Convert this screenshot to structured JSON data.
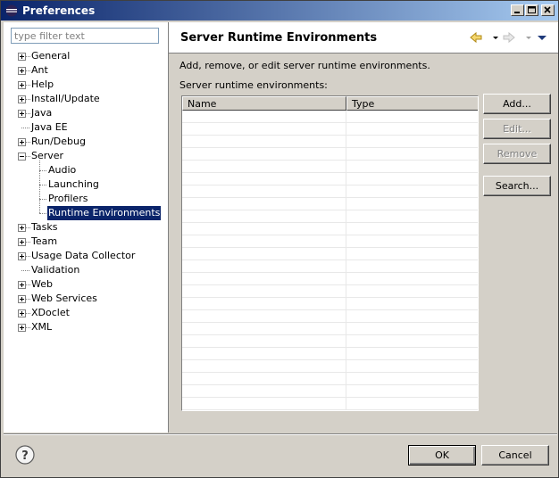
{
  "window": {
    "title": "Preferences",
    "icon": "eclipse-icon",
    "controls": [
      "minimize-icon",
      "maximize-icon",
      "close-icon"
    ]
  },
  "filter": {
    "placeholder": "type filter text",
    "value": ""
  },
  "tree": {
    "items": [
      {
        "label": "General",
        "expander": "plus"
      },
      {
        "label": "Ant",
        "expander": "plus"
      },
      {
        "label": "Help",
        "expander": "plus"
      },
      {
        "label": "Install/Update",
        "expander": "plus"
      },
      {
        "label": "Java",
        "expander": "plus"
      },
      {
        "label": "Java EE",
        "expander": "none"
      },
      {
        "label": "Run/Debug",
        "expander": "plus"
      },
      {
        "label": "Server",
        "expander": "minus",
        "children": [
          {
            "label": "Audio"
          },
          {
            "label": "Launching"
          },
          {
            "label": "Profilers"
          },
          {
            "label": "Runtime Environments",
            "selected": true
          }
        ]
      },
      {
        "label": "Tasks",
        "expander": "plus"
      },
      {
        "label": "Team",
        "expander": "plus"
      },
      {
        "label": "Usage Data Collector",
        "expander": "plus"
      },
      {
        "label": "Validation",
        "expander": "none"
      },
      {
        "label": "Web",
        "expander": "plus"
      },
      {
        "label": "Web Services",
        "expander": "plus"
      },
      {
        "label": "XDoclet",
        "expander": "plus"
      },
      {
        "label": "XML",
        "expander": "plus"
      }
    ]
  },
  "page": {
    "title": "Server Runtime Environments",
    "description": "Add, remove, or edit server runtime environments.",
    "list_label": "Server runtime environments:",
    "nav_icons": [
      "back-arrow-icon",
      "back-dropdown-icon",
      "forward-arrow-icon",
      "forward-dropdown-icon",
      "view-menu-icon"
    ]
  },
  "table": {
    "columns": [
      "Name",
      "Type"
    ],
    "rows": []
  },
  "buttons": {
    "add": "Add...",
    "edit": "Edit...",
    "remove": "Remove",
    "search": "Search..."
  },
  "footer": {
    "ok": "OK",
    "cancel": "Cancel",
    "help_icon": "help-icon"
  },
  "colors": {
    "titlebar_start": "#0a246a",
    "titlebar_end": "#a6caf0",
    "selection": "#0a246a",
    "face": "#d4d0c8"
  }
}
